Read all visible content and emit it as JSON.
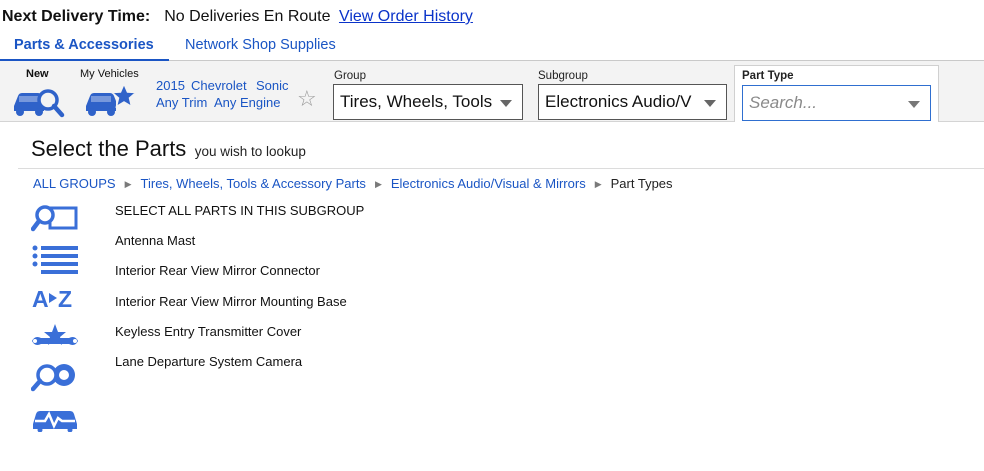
{
  "delivery": {
    "label": "Next Delivery Time:",
    "value": "No Deliveries En Route",
    "link": "View Order History"
  },
  "tabs": [
    {
      "label": "Parts & Accessories",
      "active": true
    },
    {
      "label": "Network Shop Supplies",
      "active": false
    }
  ],
  "vehicle": {
    "new_label": "New",
    "my_vehicles_label": "My Vehicles",
    "year": "2015",
    "make": "Chevrolet",
    "model": "Sonic",
    "trim": "Any Trim",
    "engine": "Any Engine"
  },
  "selectors": {
    "group": {
      "label": "Group",
      "value": "Tires, Wheels, Tools"
    },
    "subgroup": {
      "label": "Subgroup",
      "value": "Electronics Audio/V"
    },
    "part_type": {
      "label": "Part Type",
      "placeholder": "Search..."
    }
  },
  "content": {
    "title": "Select the Parts",
    "subtitle": "you wish to lookup"
  },
  "breadcrumbs": [
    "ALL GROUPS",
    "Tires, Wheels, Tools & Accessory Parts",
    "Electronics Audio/Visual & Mirrors",
    "Part Types"
  ],
  "parts": [
    "SELECT ALL PARTS IN THIS SUBGROUP",
    "Antenna Mast",
    "Interior Rear View Mirror Connector",
    "Interior Rear View Mirror Mounting Base",
    "Keyless Entry Transmitter Cover",
    "Lane Departure System Camera"
  ],
  "side_icons": [
    "search-diagram-icon",
    "list-icon",
    "a-to-z-icon",
    "service-tools-icon",
    "search-tire-icon",
    "diagnostic-car-icon"
  ],
  "colors": {
    "accent": "#1a55c4",
    "icon_blue": "#3a6fd8",
    "link": "#0a33c9"
  }
}
